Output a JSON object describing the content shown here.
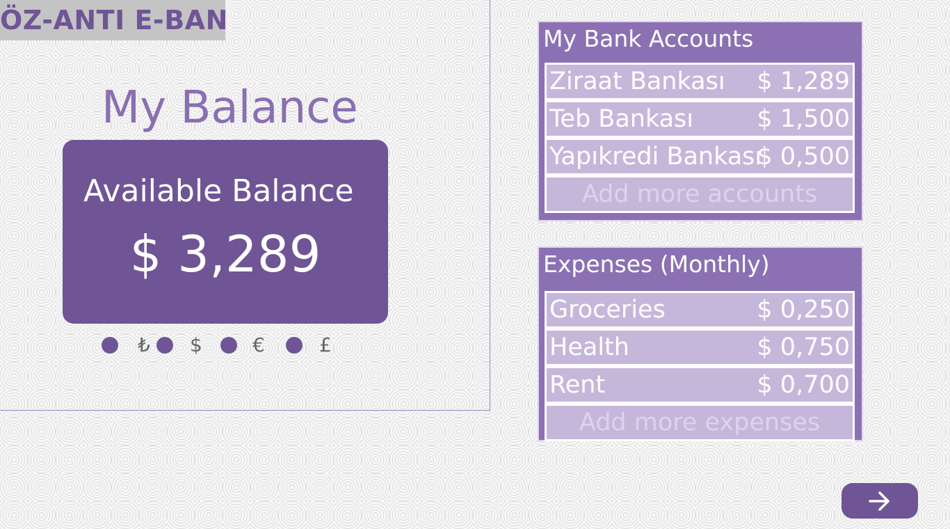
{
  "app": {
    "logo_text": "ÖZ-ANTI E-BANK"
  },
  "balance": {
    "title": "My Balance",
    "available_label": "Available Balance",
    "amount": "$ 3,289"
  },
  "currencies": [
    {
      "symbol": "₺",
      "name": "lira"
    },
    {
      "symbol": "$",
      "name": "dollar"
    },
    {
      "symbol": "€",
      "name": "euro"
    },
    {
      "symbol": "£",
      "name": "pound"
    }
  ],
  "accounts_panel": {
    "title": "My Bank Accounts",
    "items": [
      {
        "name": "Ziraat Bankası",
        "value": "$ 1,289"
      },
      {
        "name": "Teb Bankası",
        "value": "$ 1,500"
      },
      {
        "name": "Yapıkredi Bankası",
        "value": "$ 0,500"
      }
    ],
    "add_label": "Add more accounts"
  },
  "expenses_panel": {
    "title": "Expenses (Monthly)",
    "items": [
      {
        "name": "Groceries",
        "value": "$ 0,250"
      },
      {
        "name": "Health",
        "value": "$ 0,750"
      },
      {
        "name": "Rent",
        "value": "$ 0,700"
      }
    ],
    "add_label": "Add more expenses"
  },
  "nav": {
    "next_icon": "arrow-right-icon"
  },
  "colors": {
    "brand_dark": "#6f5595",
    "brand_mid": "#8b71b3",
    "brand_light": "#c5b7da"
  }
}
